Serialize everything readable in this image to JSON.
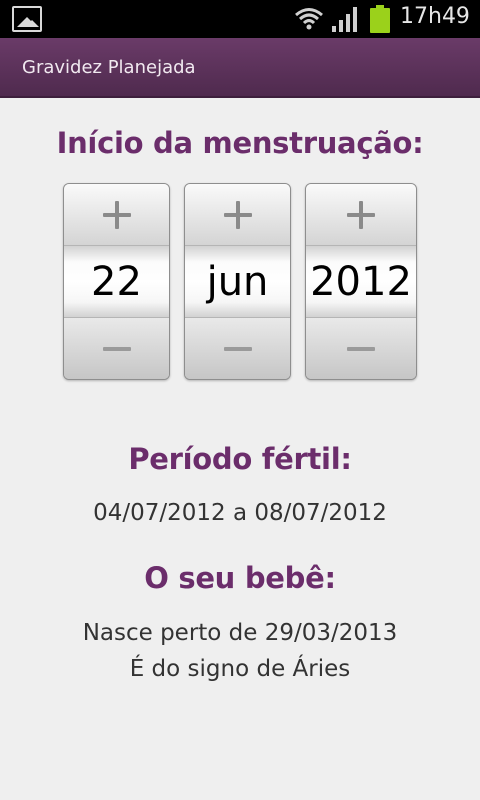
{
  "status_bar": {
    "time": "17h49",
    "icons": [
      "gallery-icon",
      "wifi-icon",
      "signal-icon",
      "battery-icon"
    ],
    "battery_color": "#9bd11b"
  },
  "action_bar": {
    "title": "Gravidez Planejada",
    "color": "#5e335c"
  },
  "date_picker": {
    "heading": "Início da menstruação:",
    "day": "22",
    "month": "jun",
    "year": "2012"
  },
  "fertile": {
    "heading": "Período fértil:",
    "range": "04/07/2012 a 08/07/2012"
  },
  "baby": {
    "heading": "O seu bebê:",
    "birth": "Nasce perto de 29/03/2013",
    "sign": "É do signo de Áries"
  },
  "colors": {
    "heading": "#6b2d6b",
    "background": "#efefef"
  }
}
